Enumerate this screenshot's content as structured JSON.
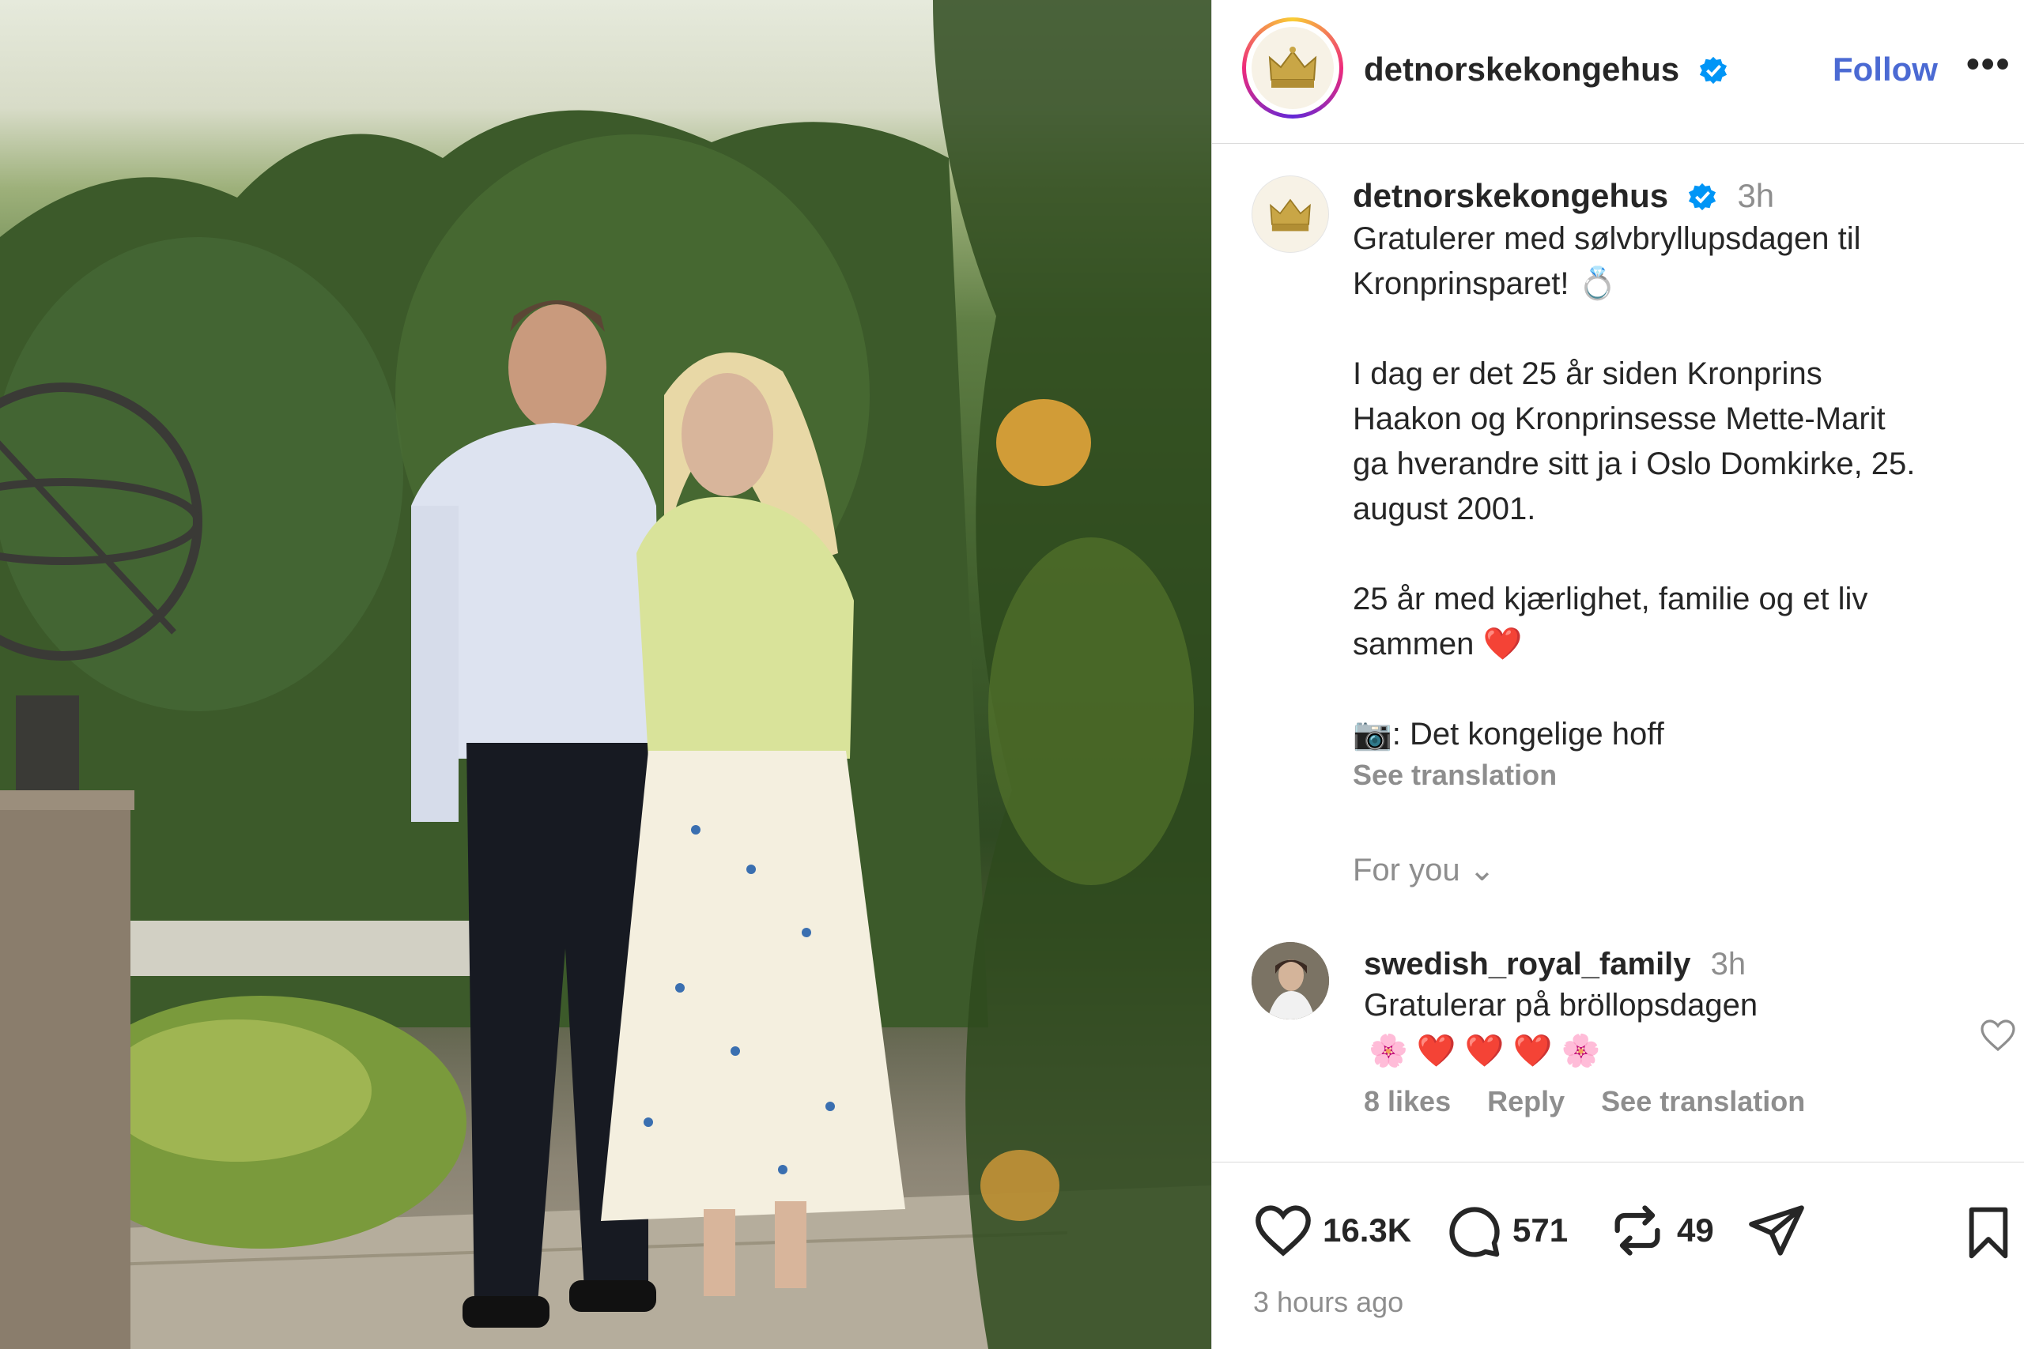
{
  "header": {
    "username": "detnorskekongehus",
    "follow_label": "Follow",
    "more_label": "•••"
  },
  "caption": {
    "username": "detnorskekongehus",
    "time": "3h",
    "line1": "Gratulerer med sølvbryllupsdagen til\nKronprinsparet! 💍",
    "line2": "I dag er det 25 år siden Kronprins\nHaakon og Kronprinsesse Mette-Marit\nga hverandre sitt ja i Oslo Domkirke, 25.\naugust 2001.",
    "line3": "25 år med kjærlighet, familie og et liv\nsammen ❤️",
    "line4": "📷: Det kongelige hoff",
    "see_translation": "See translation"
  },
  "for_you": "For you ⌄",
  "comment": {
    "username": "swedish_royal_family",
    "time": "3h",
    "text": "Gratulerar på bröllopsdagen",
    "emojis": "🌸 ❤️ ❤️ ❤️ 🌸",
    "likes": "8 likes",
    "reply": "Reply",
    "see_translation": "See translation"
  },
  "actions": {
    "likes": "16.3K",
    "comments": "571",
    "reposts": "49",
    "posted_ago": "3 hours ago"
  },
  "colors": {
    "link_blue": "#4b6ad3",
    "verified_blue": "#0095f6",
    "muted": "#8e8e8e"
  },
  "icons": [
    "crown-logo-icon",
    "verified-icon",
    "heart-icon",
    "comment-icon",
    "repost-icon",
    "share-icon",
    "bookmark-icon"
  ]
}
